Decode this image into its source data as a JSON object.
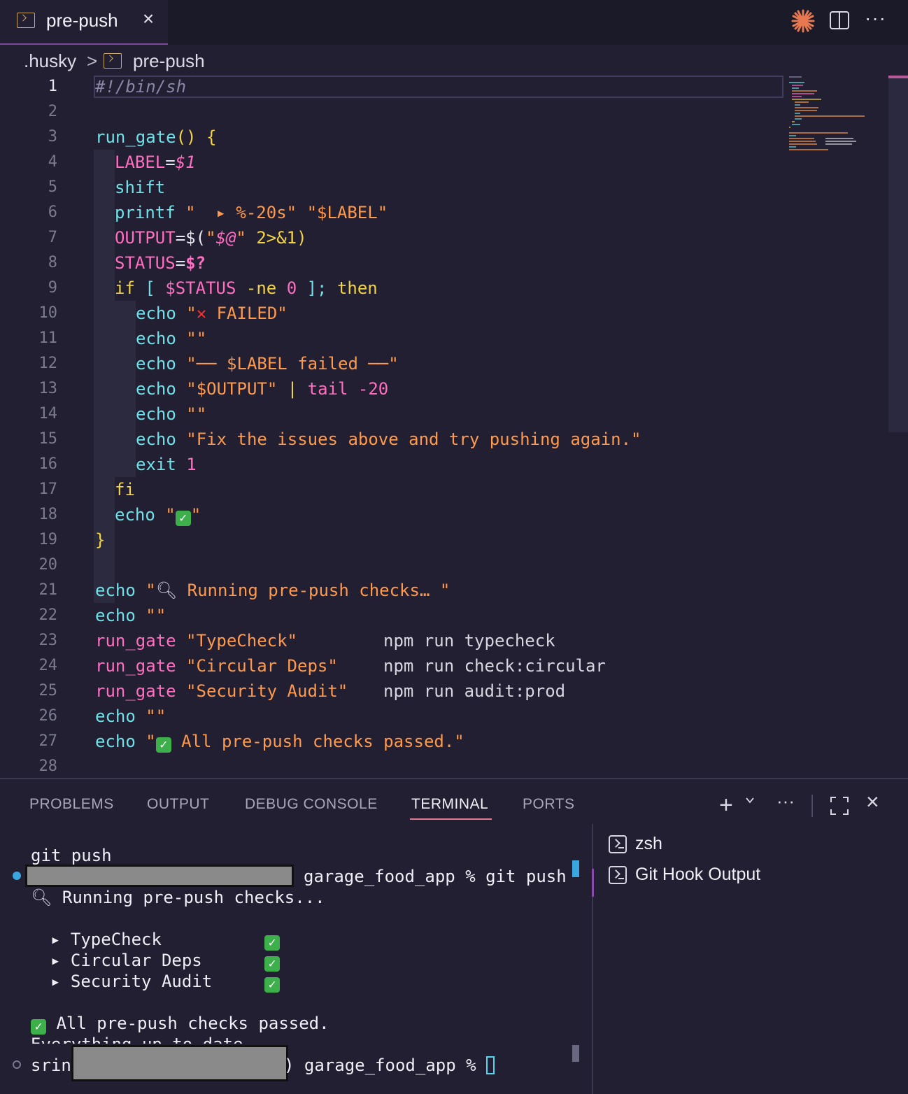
{
  "tab": {
    "title": "pre-push",
    "close": "×"
  },
  "toolbar": {
    "more": "···"
  },
  "breadcrumb": {
    "folder": ".husky",
    "separator": ">",
    "file": "pre-push"
  },
  "editor": {
    "line_numbers": [
      "1",
      "2",
      "3",
      "4",
      "5",
      "6",
      "7",
      "8",
      "9",
      "10",
      "11",
      "12",
      "13",
      "14",
      "15",
      "16",
      "17",
      "18",
      "19",
      "20",
      "21",
      "22",
      "23",
      "24",
      "25",
      "26",
      "27",
      "28"
    ],
    "code": {
      "l1": "#!/bin/sh",
      "l3_fn": "run_gate",
      "l3_paren": "()",
      "l3_brace": "{",
      "l4_var": "LABEL",
      "l4_eq": "=",
      "l4_val": "$1",
      "l5": "shift",
      "l6_cmd": "printf",
      "l6_str1": "\"  ▸ %-20s\"",
      "l6_str2": "\"$LABEL\"",
      "l7_var": "OUTPUT",
      "l7_eq": "=$(",
      "l7_q1": "\"",
      "l7_arg": "$@",
      "l7_q2": "\"",
      "l7_rest": " 2>&1)",
      "l8_var": "STATUS",
      "l8_eq": "=",
      "l8_val": "$?",
      "l9_if": "if",
      "l9_open": "[",
      "l9_var": "$STATUS",
      "l9_op": "-ne",
      "l9_num": "0",
      "l9_close": "];",
      "l9_then": "then",
      "echo": "echo",
      "l10_str": "FAILED\"",
      "l10_q": "\"",
      "l10_x": "✕",
      "empty_str": "\"\"",
      "l12_str": "\"── $LABEL failed ──\"",
      "l13_str": "\"$OUTPUT\"",
      "l13_pipe": "|",
      "l13_tail": "tail",
      "l13_num": "-20",
      "l15_str": "\"Fix the issues above and try pushing again.\"",
      "l16_exit": "exit",
      "l16_num": "1",
      "l17": "fi",
      "l18_q1": "\"",
      "l18_check": "✓",
      "l18_q2": "\"",
      "l19": "}",
      "l21_q1": "\"",
      "l21_mag": "🔍︎",
      "l21_str": "Running pre-push checks… \"",
      "l23_fn": "run_gate",
      "l23_str": "\"TypeCheck\"",
      "l23_cmd": "npm run typecheck",
      "l24_str": "\"Circular Deps\"",
      "l24_cmd": "npm run check:circular",
      "l25_str": "\"Security Audit\"",
      "l25_cmd": "npm run audit:prod",
      "l27_q1": "\"",
      "l27_check": "✓",
      "l27_str": "All pre-push checks passed.\""
    }
  },
  "panel": {
    "tabs": [
      "PROBLEMS",
      "OUTPUT",
      "DEBUG CONSOLE",
      "TERMINAL",
      "PORTS"
    ],
    "actions": {
      "plus": "+",
      "more": "···",
      "close": "×"
    }
  },
  "terminal": {
    "line1": "git push",
    "prompt1_rest": "garage_food_app % git push",
    "running_mag": "🔍︎",
    "running": "Running pre-push checks...",
    "checks": [
      {
        "label": "▸ TypeCheck",
        "status": "✓"
      },
      {
        "label": "▸ Circular Deps",
        "status": "✓"
      },
      {
        "label": "▸ Security Audit",
        "status": "✓"
      }
    ],
    "passed_check": "✓",
    "passed": "All pre-push checks passed.",
    "uptodate": "Everything up-to-date",
    "prompt2_user": "srin",
    "prompt2_rest": ") garage_food_app %"
  },
  "terminal_list": [
    {
      "label": "zsh"
    },
    {
      "label": "Git Hook Output"
    }
  ],
  "colors": {
    "background": "#211f31",
    "accent": "#7a4a9e",
    "function": "#6ee2e8",
    "string": "#ff9a4c",
    "variable": "#ff6ec0",
    "keyword": "#f3d444"
  }
}
